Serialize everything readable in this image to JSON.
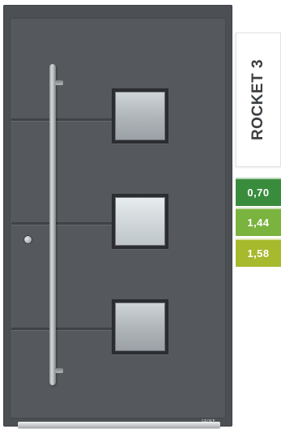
{
  "product": {
    "name": "ROCKET 3",
    "values": [
      {
        "label": "0,70",
        "color": "#3a8c3d"
      },
      {
        "label": "1,44",
        "color": "#7ab33e"
      },
      {
        "label": "1,58",
        "color": "#a7b92c"
      }
    ]
  },
  "door": {
    "color": "#4c4f53",
    "glass_panes": 3,
    "brand_plate": "GROKE"
  }
}
